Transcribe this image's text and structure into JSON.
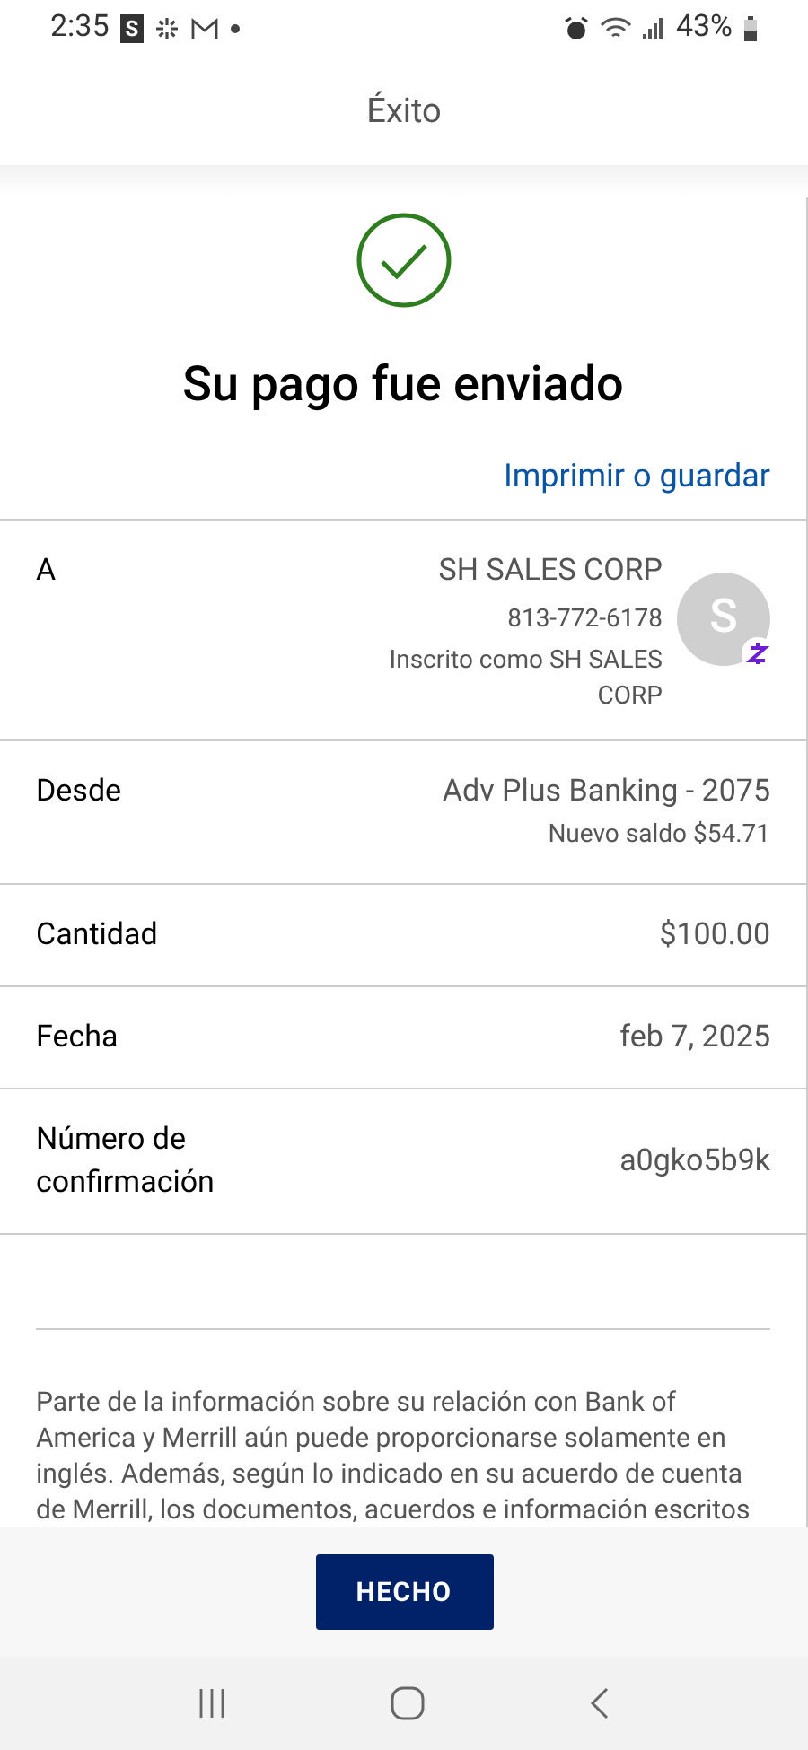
{
  "status_bar": {
    "time": "2:35",
    "app_badge": "S",
    "battery": "43%"
  },
  "header": {
    "title": "Éxito"
  },
  "success": {
    "title": "Su pago fue enviado",
    "link": "Imprimir o guardar"
  },
  "recipient": {
    "label": "A",
    "name": "SH SALES CORP",
    "phone": "813-772-6178",
    "enrolled": "Inscrito como SH SALES CORP",
    "avatar_letter": "S"
  },
  "details": [
    {
      "label": "Desde",
      "value": "Adv Plus Banking - 2075",
      "sub": "Nuevo saldo $54.71"
    },
    {
      "label": "Cantidad",
      "value": "$100.00"
    },
    {
      "label": "Fecha",
      "value": "feb 7, 2025"
    },
    {
      "label": "Número de confirmación",
      "value": "a0gko5b9k"
    }
  ],
  "disclaimer": "Parte de la información sobre su relación con Bank of America y Merrill aún puede proporcionarse solamente en inglés. Además, según lo indicado en su acuerdo de cuenta de Merrill, los documentos, acuerdos e información escritos",
  "footer": {
    "button": "HECHO"
  }
}
